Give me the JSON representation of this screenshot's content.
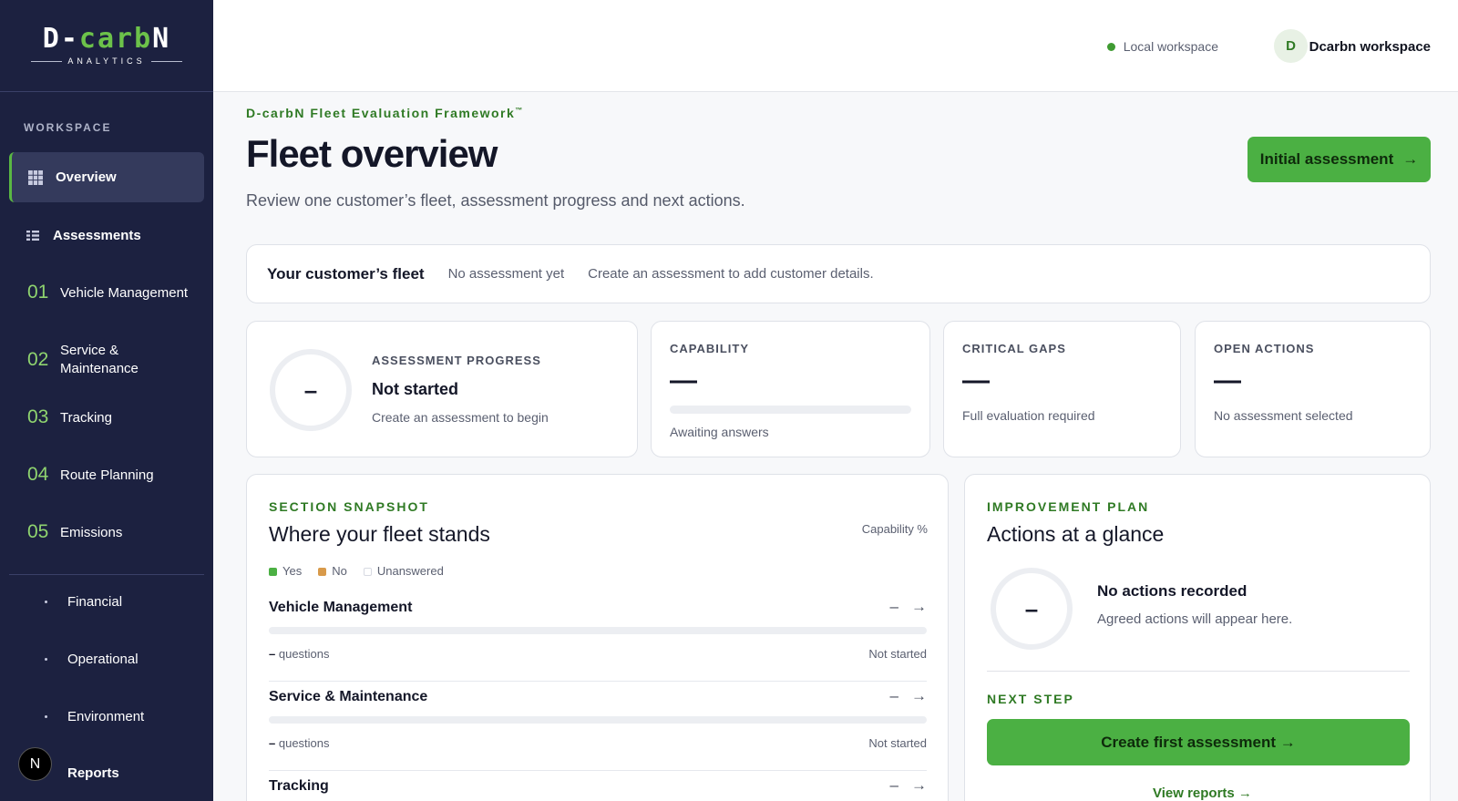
{
  "sidebar": {
    "logo": {
      "main_a": "D-",
      "main_b": "carb",
      "main_c": "N",
      "sub": "ANALYTICS"
    },
    "section_label": "WORKSPACE",
    "items": [
      {
        "label": "Overview",
        "icon": "grid-icon",
        "active": true
      },
      {
        "label": "Assessments",
        "icon": "list-icon"
      },
      {
        "num": "01",
        "label": "Vehicle Management"
      },
      {
        "num": "02",
        "label": "Service & Maintenance"
      },
      {
        "num": "03",
        "label": "Tracking"
      },
      {
        "num": "04",
        "label": "Route Planning"
      },
      {
        "num": "05",
        "label": "Emissions"
      }
    ],
    "sub_items": [
      {
        "label": "Financial"
      },
      {
        "label": "Operational"
      },
      {
        "label": "Environment"
      },
      {
        "label": "Reports"
      }
    ],
    "badge": "N"
  },
  "header": {
    "local_workspace": "Local workspace",
    "avatar_initial": "D",
    "workspace_name": "Dcarbn workspace"
  },
  "main": {
    "eyebrow": "D-carbN Fleet Evaluation Framework",
    "trademark": "™",
    "title": "Fleet overview",
    "subtitle": "Review one customer’s fleet, assessment progress and next actions.",
    "primary_button": "Initial assessment",
    "arrow": "→",
    "fleet_bar": {
      "title": "Your customer’s fleet",
      "status": "No assessment yet",
      "hint": "Create an assessment to add customer details."
    },
    "stats": {
      "progress": {
        "label": "ASSESSMENT PROGRESS",
        "ring": "–",
        "value": "Not started",
        "note": "Create an assessment to begin"
      },
      "capability": {
        "label": "CAPABILITY",
        "value": "—",
        "note": "Awaiting answers",
        "fill": 0
      },
      "critical": {
        "label": "CRITICAL GAPS",
        "value": "—",
        "note": "Full evaluation required"
      },
      "actions": {
        "label": "OPEN ACTIONS",
        "value": "—",
        "note": "No assessment selected"
      }
    },
    "snapshot": {
      "eyebrow": "SECTION SNAPSHOT",
      "title": "Where your fleet stands",
      "right_label": "Capability %",
      "legend": [
        {
          "label": "Yes",
          "color": "#4bb043"
        },
        {
          "label": "No",
          "color": "#d89a4a"
        },
        {
          "label": "Unanswered",
          "color": "#e6e8ee"
        }
      ],
      "rows": [
        {
          "title": "Vehicle Management",
          "value": "–",
          "questions_count": "–",
          "questions_label": "questions",
          "status": "Not started"
        },
        {
          "title": "Service & Maintenance",
          "value": "–",
          "questions_count": "–",
          "questions_label": "questions",
          "status": "Not started"
        },
        {
          "title": "Tracking",
          "value": "–"
        }
      ]
    },
    "plan": {
      "eyebrow": "IMPROVEMENT PLAN",
      "title": "Actions at a glance",
      "ring": "–",
      "heading": "No actions recorded",
      "note": "Agreed actions will appear here.",
      "next_step_label": "NEXT STEP",
      "cta": "Create first assessment →",
      "link": "View reports →"
    }
  }
}
